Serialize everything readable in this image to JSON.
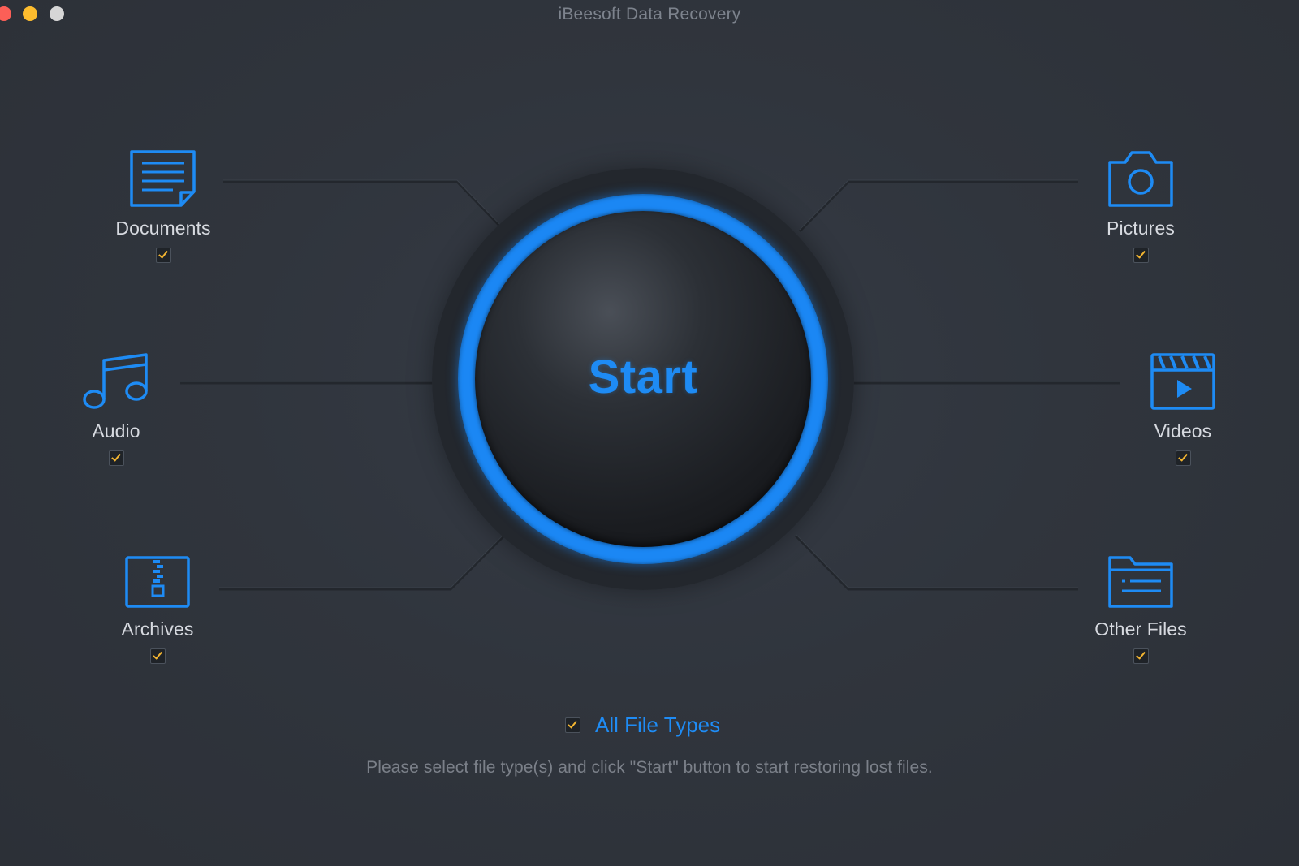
{
  "window": {
    "title": "iBeesoft Data Recovery"
  },
  "file_types": {
    "documents": {
      "label": "Documents",
      "checked": true,
      "icon": "document-icon"
    },
    "audio": {
      "label": "Audio",
      "checked": true,
      "icon": "music-note-icon"
    },
    "archives": {
      "label": "Archives",
      "checked": true,
      "icon": "archive-zip-icon"
    },
    "pictures": {
      "label": "Pictures",
      "checked": true,
      "icon": "camera-icon"
    },
    "videos": {
      "label": "Videos",
      "checked": true,
      "icon": "video-clapper-icon"
    },
    "other_files": {
      "label": "Other Files",
      "checked": true,
      "icon": "folder-icon"
    }
  },
  "start_button": {
    "label": "Start"
  },
  "all_file_types": {
    "label": "All File Types",
    "checked": true
  },
  "hint": "Please select file type(s) and click \"Start\" button to start restoring lost files.",
  "colors": {
    "accent_blue": "#1e8bf4",
    "check_orange": "#f3b531",
    "background": "#2f343c"
  }
}
